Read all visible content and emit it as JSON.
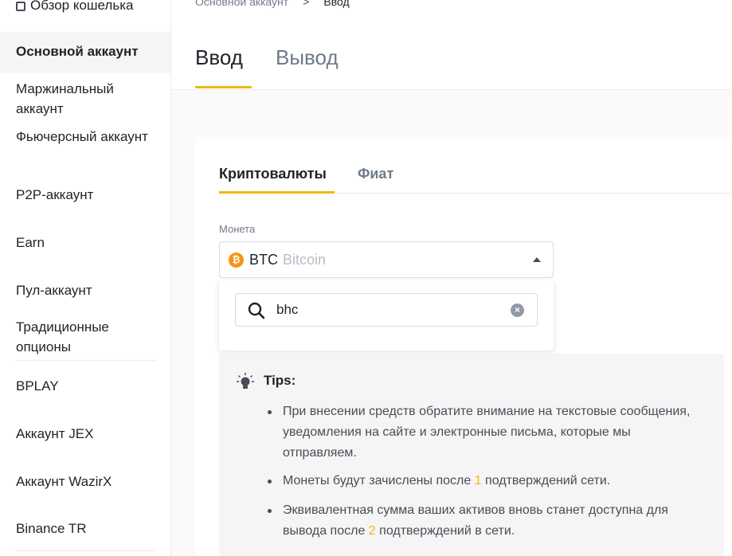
{
  "sidebar": {
    "items": [
      {
        "label": "Обзор кошелька"
      },
      {
        "label": "Основной аккаунт"
      },
      {
        "label": "Маржинальный аккаунт"
      },
      {
        "label": "Фьючерсный аккаунт"
      },
      {
        "label": "P2P-аккаунт"
      },
      {
        "label": "Earn"
      },
      {
        "label": "Пул-аккаунт"
      },
      {
        "label": "Традиционные опционы"
      },
      {
        "label": "BPLAY"
      },
      {
        "label": "Аккаунт JEX"
      },
      {
        "label": "Аккаунт WazirX"
      },
      {
        "label": "Binance TR"
      }
    ],
    "active_index": 1
  },
  "breadcrumb": {
    "parent": "Основной аккаунт",
    "separator": ">",
    "current": "Ввод"
  },
  "main_tabs": [
    {
      "label": "Ввод"
    },
    {
      "label": "Вывод"
    }
  ],
  "sub_tabs": [
    {
      "label": "Криптовалюты"
    },
    {
      "label": "Фиат"
    }
  ],
  "coin": {
    "label": "Монета",
    "symbol": "BTC",
    "name": "Bitcoin",
    "icon_glyph": "₿",
    "icon_color": "#f7931a"
  },
  "search": {
    "value": "bhc"
  },
  "tips": {
    "title": "Tips:",
    "items": [
      {
        "text": "При внесении средств обратите внимание на текстовые сообщения, уведомления на сайте и электронные письма, которые мы отправляем."
      },
      {
        "before": "Монеты будут зачислены после ",
        "highlight": "1",
        "after": " подтверждений сети."
      },
      {
        "before": "Эквивалентная сумма ваших активов вновь станет доступна для вывода после ",
        "highlight": "2",
        "after": " подтверждений в сети."
      }
    ]
  },
  "colors": {
    "accent": "#f0b90b",
    "text": "#1e2329",
    "muted": "#707a8a"
  }
}
